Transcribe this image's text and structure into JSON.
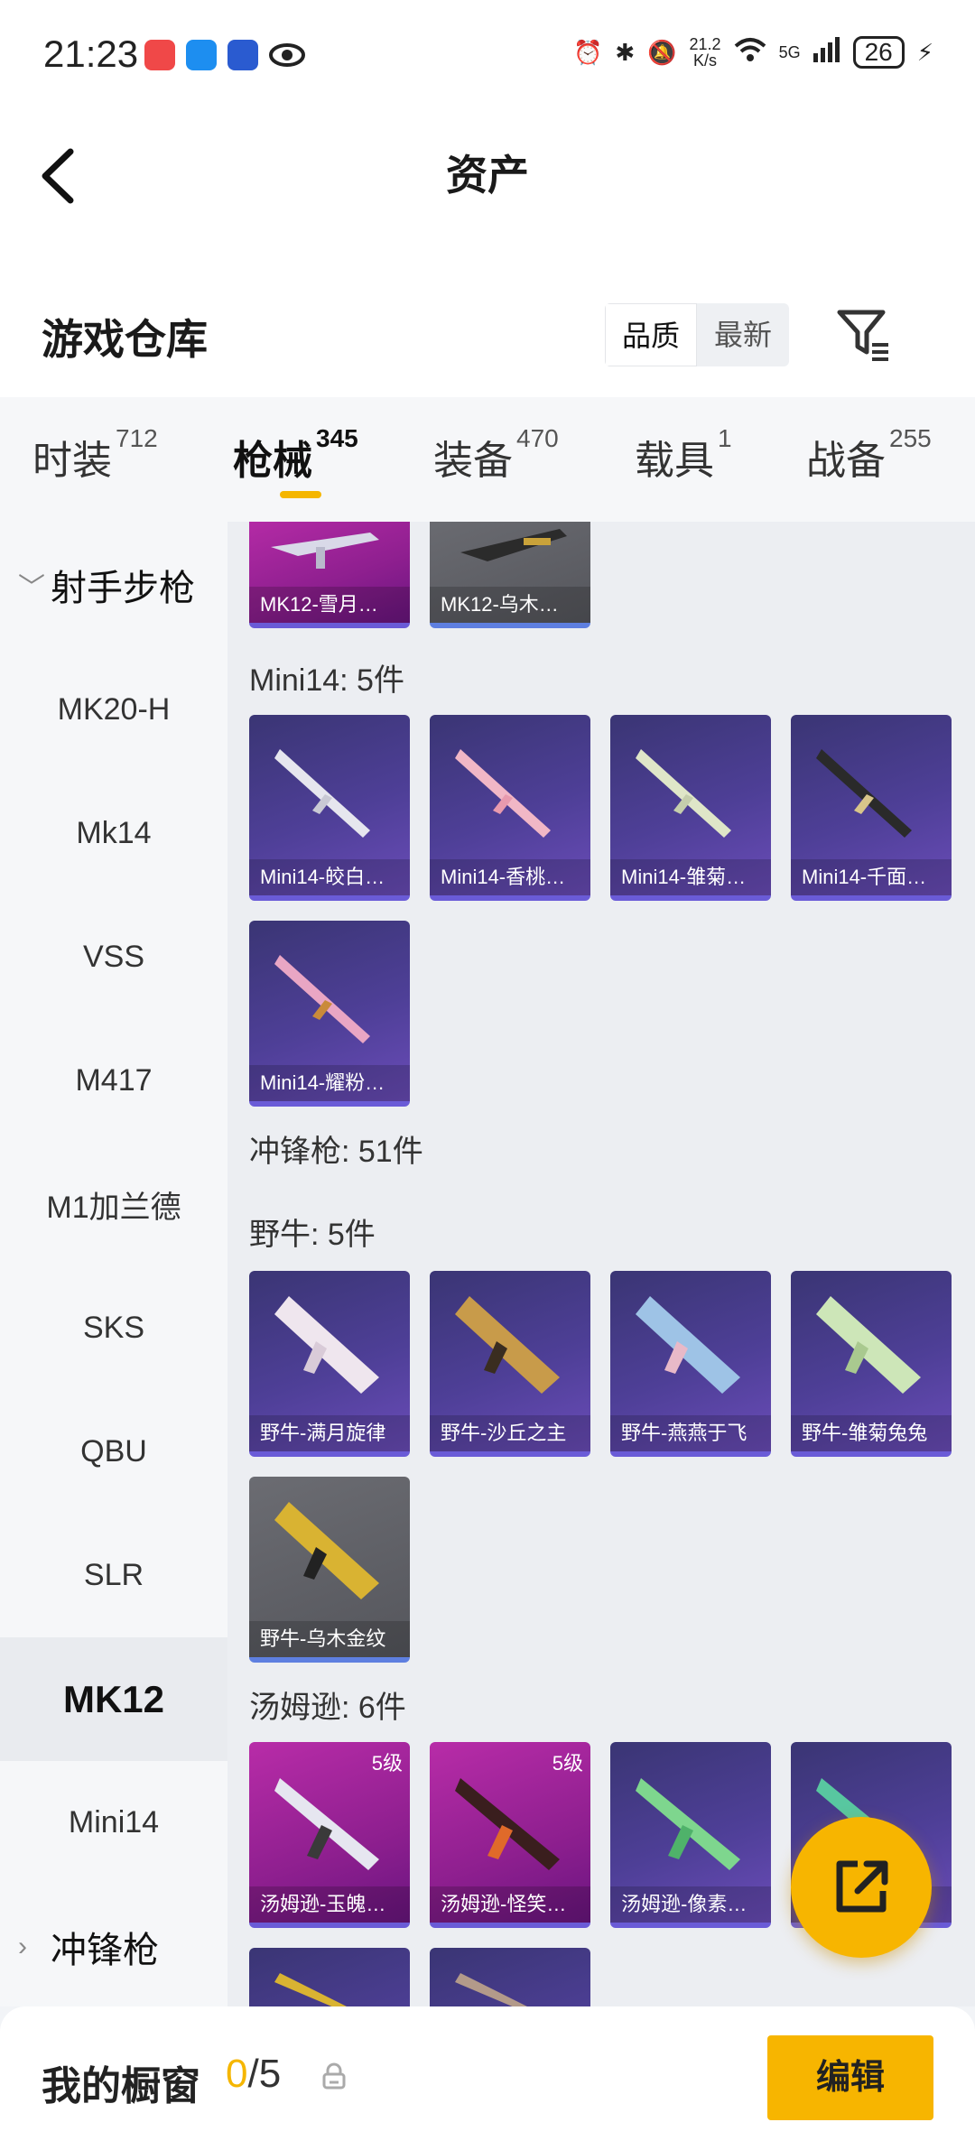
{
  "status_bar": {
    "time": "21:23",
    "net_speed_value": "21.2",
    "net_speed_unit": "K/s",
    "network": "5G",
    "battery": "26"
  },
  "nav": {
    "title": "资产"
  },
  "warehouse": {
    "title": "游戏仓库",
    "sort_options": [
      "品质",
      "最新"
    ],
    "sort_selected": "品质"
  },
  "tabs": [
    {
      "label": "时装",
      "count": "712"
    },
    {
      "label": "枪械",
      "count": "345"
    },
    {
      "label": "装备",
      "count": "470"
    },
    {
      "label": "载具",
      "count": "1"
    },
    {
      "label": "战备",
      "count": "255"
    }
  ],
  "active_tab": "枪械",
  "sidebar": {
    "category": "射手步枪",
    "items": [
      "MK20-H",
      "Mk14",
      "VSS",
      "M417",
      "M1加兰德",
      "SKS",
      "QBU",
      "SLR",
      "MK12",
      "Mini14"
    ],
    "active_item": "MK12",
    "next_category": "冲锋枪"
  },
  "content": {
    "mk12_cards": [
      {
        "label": "MK12-雪月…",
        "rarity": "pink"
      },
      {
        "label": "MK12-乌木…",
        "rarity": "gray"
      }
    ],
    "mini14": {
      "title": "Mini14: 5件",
      "cards": [
        "Mini14-皎白…",
        "Mini14-香桃…",
        "Mini14-雏菊…",
        "Mini14-千面…",
        "Mini14-耀粉…"
      ]
    },
    "smg_section": "冲锋枪: 51件",
    "bull": {
      "title": "野牛: 5件",
      "cards": [
        "野牛-满月旋律",
        "野牛-沙丘之主",
        "野牛-燕燕于飞",
        "野牛-雏菊兔兔",
        "野牛-乌木金纹"
      ]
    },
    "thompson": {
      "title": "汤姆逊: 6件",
      "cards": [
        {
          "label": "汤姆逊-玉魄…",
          "badge": "5级"
        },
        {
          "label": "汤姆逊-怪笑…",
          "badge": "5级"
        },
        {
          "label": "汤姆逊-像素…",
          "badge": ""
        },
        {
          "label": "…",
          "badge": ""
        }
      ]
    }
  },
  "bottom": {
    "title": "我的橱窗",
    "count_current": "0",
    "count_total": "/5",
    "edit_label": "编辑"
  },
  "colors": {
    "accent": "#f7b500",
    "card_blue": "#4e3f97",
    "card_pink": "#b82ca8",
    "card_gray": "#5e5f65"
  }
}
